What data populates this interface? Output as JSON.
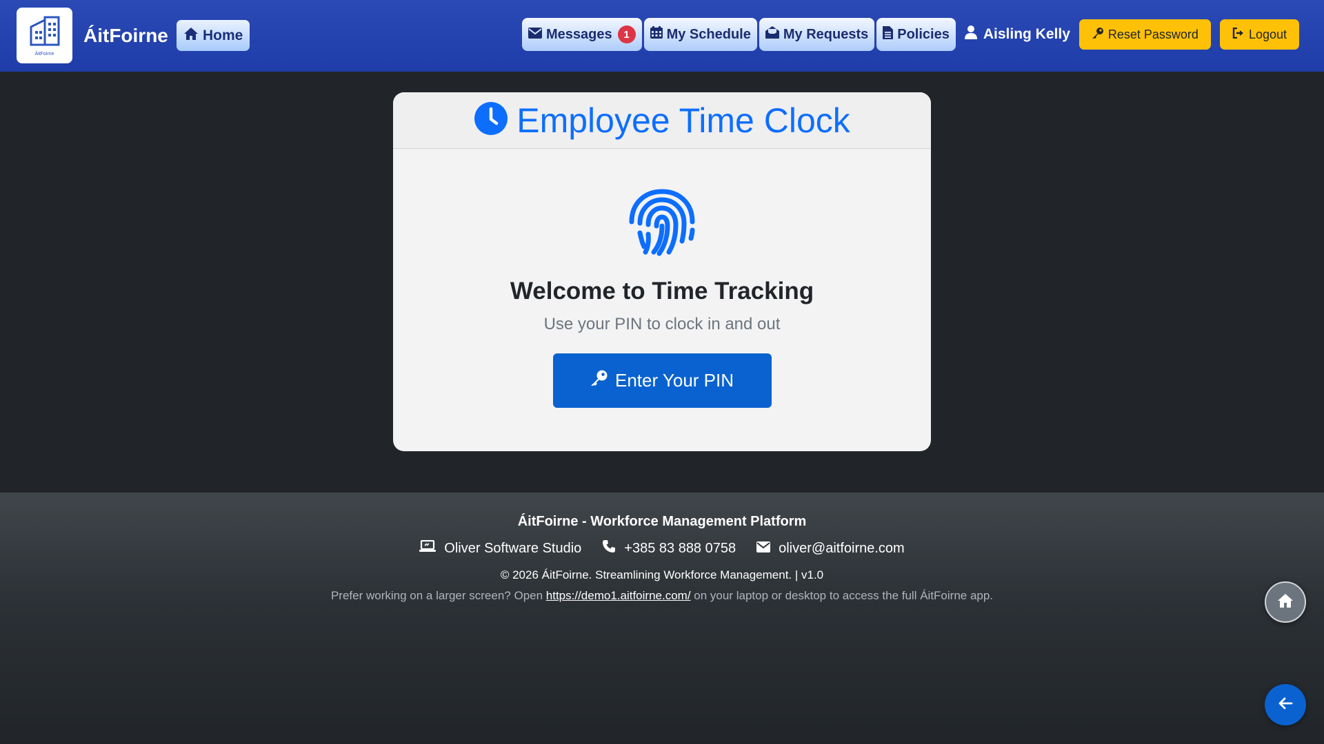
{
  "navbar": {
    "brand_name": "ÁitFoirne",
    "brand_logo_caption": "ÁitFoirne",
    "home_label": "Home",
    "messages_label": "Messages",
    "messages_count": "1",
    "schedule_label": "My Schedule",
    "requests_label": "My Requests",
    "policies_label": "Policies",
    "user_name": "Aisling Kelly",
    "reset_password_label": "Reset Password",
    "logout_label": "Logout"
  },
  "card": {
    "title": "Employee Time Clock",
    "welcome_title": "Welcome to Time Tracking",
    "welcome_subtitle": "Use your PIN to clock in and out",
    "pin_button_label": "Enter Your PIN"
  },
  "footer": {
    "title": "ÁitFoirne - Workforce Management Platform",
    "company": "Oliver Software Studio",
    "phone": "+385 83 888 0758",
    "email": "oliver@aitfoirne.com",
    "copyright": "© 2026 ÁitFoirne. Streamlining Workforce Management. | v1.0",
    "note_before": "Prefer working on a larger screen? Open ",
    "note_link": "https://demo1.aitfoirne.com/",
    "note_after": " on your laptop or desktop to access the full ÁitFoirne app."
  },
  "colors": {
    "navbar": "#1f3da8",
    "primary": "#0d6efd",
    "button_primary": "#0a62d0",
    "warning": "#ffc107",
    "badge": "#dc3545",
    "page_background": "#212529"
  },
  "icons": {
    "brand": "building-icon",
    "home": "home-icon",
    "messages": "envelope-icon",
    "schedule": "calendar-icon",
    "requests": "envelope-open-icon",
    "policies": "file-icon",
    "user": "user-icon",
    "reset": "key-icon",
    "logout": "sign-out-icon",
    "title": "clock-icon",
    "hero": "fingerprint-icon",
    "company": "laptop-icon",
    "phone": "phone-icon",
    "email": "envelope-icon",
    "fab_home": "home-icon",
    "fab_back": "arrow-left-icon"
  }
}
